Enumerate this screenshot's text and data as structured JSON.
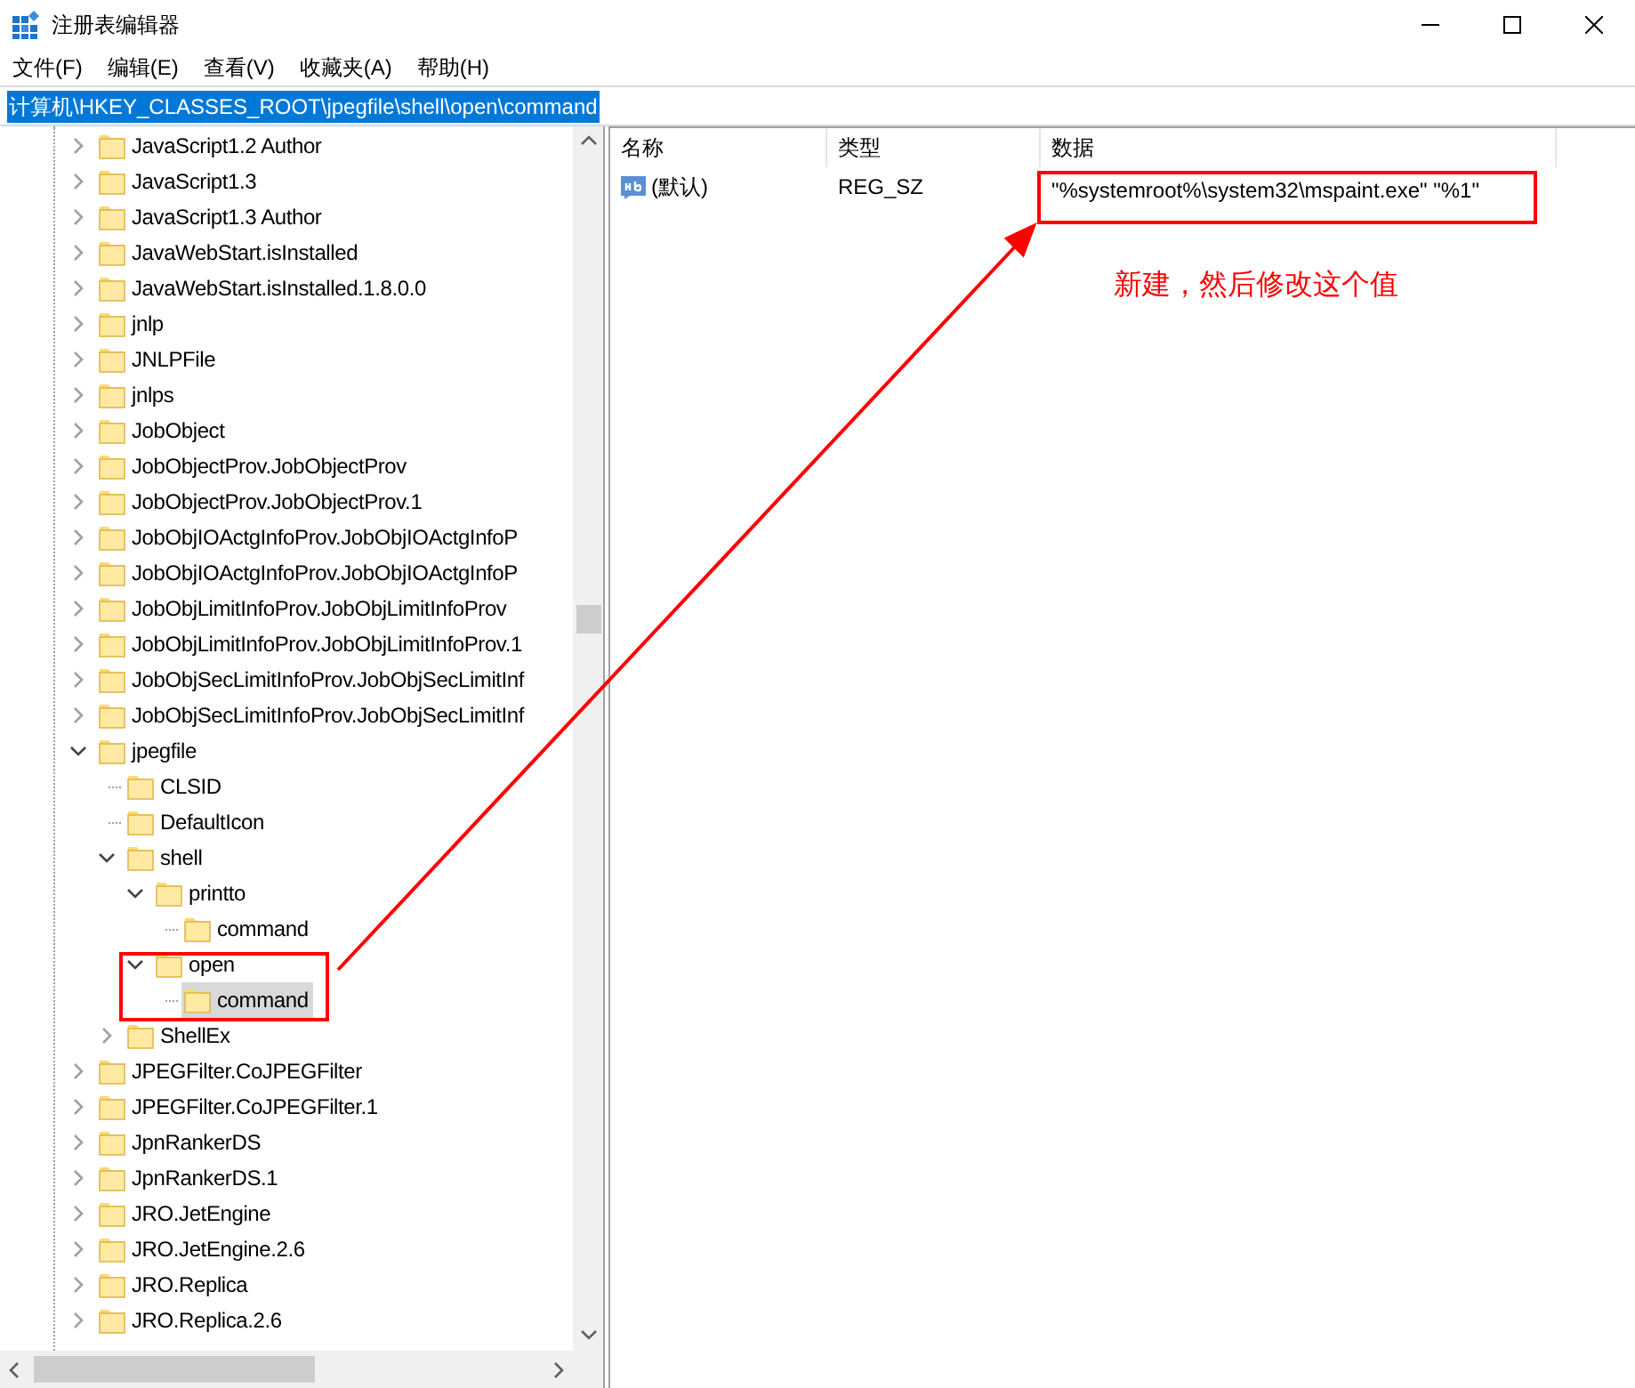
{
  "window": {
    "title": "注册表编辑器"
  },
  "menu": [
    "文件(F)",
    "编辑(E)",
    "查看(V)",
    "收藏夹(A)",
    "帮助(H)"
  ],
  "address": {
    "value": "计算机\\HKEY_CLASSES_ROOT\\jpegfile\\shell\\open\\command"
  },
  "tree": [
    {
      "label": "JavaScript1.2 Author",
      "expandable": true,
      "expanded": false,
      "selected": false
    },
    {
      "label": "JavaScript1.3",
      "expandable": true,
      "expanded": false,
      "selected": false
    },
    {
      "label": "JavaScript1.3 Author",
      "expandable": true,
      "expanded": false,
      "selected": false
    },
    {
      "label": "JavaWebStart.isInstalled",
      "expandable": true,
      "expanded": false,
      "selected": false
    },
    {
      "label": "JavaWebStart.isInstalled.1.8.0.0",
      "expandable": true,
      "expanded": false,
      "selected": false
    },
    {
      "label": "jnlp",
      "expandable": true,
      "expanded": false,
      "selected": false
    },
    {
      "label": "JNLPFile",
      "expandable": true,
      "expanded": false,
      "selected": false
    },
    {
      "label": "jnlps",
      "expandable": true,
      "expanded": false,
      "selected": false
    },
    {
      "label": "JobObject",
      "expandable": true,
      "expanded": false,
      "selected": false
    },
    {
      "label": "JobObjectProv.JobObjectProv",
      "expandable": true,
      "expanded": false,
      "selected": false
    },
    {
      "label": "JobObjectProv.JobObjectProv.1",
      "expandable": true,
      "expanded": false,
      "selected": false
    },
    {
      "label": "JobObjIOActgInfoProv.JobObjIOActgInfoP",
      "expandable": true,
      "expanded": false,
      "selected": false
    },
    {
      "label": "JobObjIOActgInfoProv.JobObjIOActgInfoP",
      "expandable": true,
      "expanded": false,
      "selected": false
    },
    {
      "label": "JobObjLimitInfoProv.JobObjLimitInfoProv",
      "expandable": true,
      "expanded": false,
      "selected": false
    },
    {
      "label": "JobObjLimitInfoProv.JobObjLimitInfoProv.1",
      "expandable": true,
      "expanded": false,
      "selected": false
    },
    {
      "label": "JobObjSecLimitInfoProv.JobObjSecLimitInf",
      "expandable": true,
      "expanded": false,
      "selected": false
    },
    {
      "label": "JobObjSecLimitInfoProv.JobObjSecLimitInf",
      "expandable": true,
      "expanded": false,
      "selected": false
    },
    {
      "label": "jpegfile",
      "expandable": true,
      "expanded": true,
      "selected": false,
      "children": [
        {
          "label": "CLSID",
          "expandable": false,
          "selected": false
        },
        {
          "label": "DefaultIcon",
          "expandable": false,
          "selected": false
        },
        {
          "label": "shell",
          "expandable": true,
          "expanded": true,
          "selected": false,
          "children": [
            {
              "label": "printto",
              "expandable": true,
              "expanded": true,
              "selected": false,
              "children": [
                {
                  "label": "command",
                  "expandable": false,
                  "selected": false
                }
              ]
            },
            {
              "label": "open",
              "expandable": true,
              "expanded": true,
              "selected": false,
              "children": [
                {
                  "label": "command",
                  "expandable": false,
                  "selected": true
                }
              ]
            }
          ]
        },
        {
          "label": "ShellEx",
          "expandable": true,
          "expanded": false,
          "selected": false
        }
      ]
    },
    {
      "label": "JPEGFilter.CoJPEGFilter",
      "expandable": true,
      "expanded": false,
      "selected": false
    },
    {
      "label": "JPEGFilter.CoJPEGFilter.1",
      "expandable": true,
      "expanded": false,
      "selected": false
    },
    {
      "label": "JpnRankerDS",
      "expandable": true,
      "expanded": false,
      "selected": false
    },
    {
      "label": "JpnRankerDS.1",
      "expandable": true,
      "expanded": false,
      "selected": false
    },
    {
      "label": "JRO.JetEngine",
      "expandable": true,
      "expanded": false,
      "selected": false
    },
    {
      "label": "JRO.JetEngine.2.6",
      "expandable": true,
      "expanded": false,
      "selected": false
    },
    {
      "label": "JRO.Replica",
      "expandable": true,
      "expanded": false,
      "selected": false
    },
    {
      "label": "JRO.Replica.2.6",
      "expandable": true,
      "expanded": false,
      "selected": false
    }
  ],
  "values": {
    "columns": [
      "名称",
      "类型",
      "数据"
    ],
    "rows": [
      {
        "name": "(默认)",
        "type": "REG_SZ",
        "data": "\"%systemroot%\\system32\\mspaint.exe\" \"%1\""
      }
    ]
  },
  "annotation": {
    "note": "新建，然后修改这个值"
  }
}
